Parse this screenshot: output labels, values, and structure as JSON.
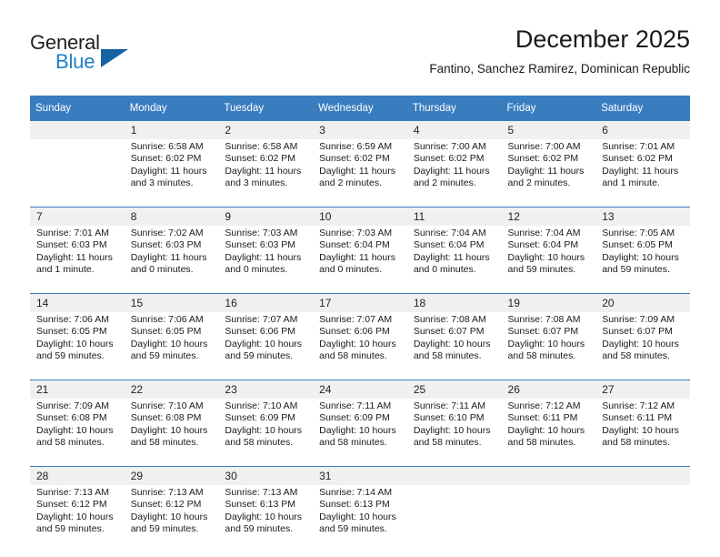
{
  "brand": {
    "name_part1": "General",
    "name_part2": "Blue",
    "triangle_icon": "triangle-icon",
    "color_dark": "#231f20",
    "color_blue": "#1f7fc4"
  },
  "header": {
    "title": "December 2025",
    "subtitle": "Fantino, Sanchez Ramirez, Dominican Republic"
  },
  "theme": {
    "header_bg": "#3a7dbf",
    "daynum_bg": "#f0f0f0",
    "cell_bg": "#ffffff"
  },
  "weekdays": [
    "Sunday",
    "Monday",
    "Tuesday",
    "Wednesday",
    "Thursday",
    "Friday",
    "Saturday"
  ],
  "weeks": [
    {
      "days": [
        {
          "num": "",
          "sunrise": "",
          "sunset": "",
          "daylight1": "",
          "daylight2": ""
        },
        {
          "num": "1",
          "sunrise": "Sunrise: 6:58 AM",
          "sunset": "Sunset: 6:02 PM",
          "daylight1": "Daylight: 11 hours",
          "daylight2": "and 3 minutes."
        },
        {
          "num": "2",
          "sunrise": "Sunrise: 6:58 AM",
          "sunset": "Sunset: 6:02 PM",
          "daylight1": "Daylight: 11 hours",
          "daylight2": "and 3 minutes."
        },
        {
          "num": "3",
          "sunrise": "Sunrise: 6:59 AM",
          "sunset": "Sunset: 6:02 PM",
          "daylight1": "Daylight: 11 hours",
          "daylight2": "and 2 minutes."
        },
        {
          "num": "4",
          "sunrise": "Sunrise: 7:00 AM",
          "sunset": "Sunset: 6:02 PM",
          "daylight1": "Daylight: 11 hours",
          "daylight2": "and 2 minutes."
        },
        {
          "num": "5",
          "sunrise": "Sunrise: 7:00 AM",
          "sunset": "Sunset: 6:02 PM",
          "daylight1": "Daylight: 11 hours",
          "daylight2": "and 2 minutes."
        },
        {
          "num": "6",
          "sunrise": "Sunrise: 7:01 AM",
          "sunset": "Sunset: 6:02 PM",
          "daylight1": "Daylight: 11 hours",
          "daylight2": "and 1 minute."
        }
      ]
    },
    {
      "days": [
        {
          "num": "7",
          "sunrise": "Sunrise: 7:01 AM",
          "sunset": "Sunset: 6:03 PM",
          "daylight1": "Daylight: 11 hours",
          "daylight2": "and 1 minute."
        },
        {
          "num": "8",
          "sunrise": "Sunrise: 7:02 AM",
          "sunset": "Sunset: 6:03 PM",
          "daylight1": "Daylight: 11 hours",
          "daylight2": "and 0 minutes."
        },
        {
          "num": "9",
          "sunrise": "Sunrise: 7:03 AM",
          "sunset": "Sunset: 6:03 PM",
          "daylight1": "Daylight: 11 hours",
          "daylight2": "and 0 minutes."
        },
        {
          "num": "10",
          "sunrise": "Sunrise: 7:03 AM",
          "sunset": "Sunset: 6:04 PM",
          "daylight1": "Daylight: 11 hours",
          "daylight2": "and 0 minutes."
        },
        {
          "num": "11",
          "sunrise": "Sunrise: 7:04 AM",
          "sunset": "Sunset: 6:04 PM",
          "daylight1": "Daylight: 11 hours",
          "daylight2": "and 0 minutes."
        },
        {
          "num": "12",
          "sunrise": "Sunrise: 7:04 AM",
          "sunset": "Sunset: 6:04 PM",
          "daylight1": "Daylight: 10 hours",
          "daylight2": "and 59 minutes."
        },
        {
          "num": "13",
          "sunrise": "Sunrise: 7:05 AM",
          "sunset": "Sunset: 6:05 PM",
          "daylight1": "Daylight: 10 hours",
          "daylight2": "and 59 minutes."
        }
      ]
    },
    {
      "days": [
        {
          "num": "14",
          "sunrise": "Sunrise: 7:06 AM",
          "sunset": "Sunset: 6:05 PM",
          "daylight1": "Daylight: 10 hours",
          "daylight2": "and 59 minutes."
        },
        {
          "num": "15",
          "sunrise": "Sunrise: 7:06 AM",
          "sunset": "Sunset: 6:05 PM",
          "daylight1": "Daylight: 10 hours",
          "daylight2": "and 59 minutes."
        },
        {
          "num": "16",
          "sunrise": "Sunrise: 7:07 AM",
          "sunset": "Sunset: 6:06 PM",
          "daylight1": "Daylight: 10 hours",
          "daylight2": "and 59 minutes."
        },
        {
          "num": "17",
          "sunrise": "Sunrise: 7:07 AM",
          "sunset": "Sunset: 6:06 PM",
          "daylight1": "Daylight: 10 hours",
          "daylight2": "and 58 minutes."
        },
        {
          "num": "18",
          "sunrise": "Sunrise: 7:08 AM",
          "sunset": "Sunset: 6:07 PM",
          "daylight1": "Daylight: 10 hours",
          "daylight2": "and 58 minutes."
        },
        {
          "num": "19",
          "sunrise": "Sunrise: 7:08 AM",
          "sunset": "Sunset: 6:07 PM",
          "daylight1": "Daylight: 10 hours",
          "daylight2": "and 58 minutes."
        },
        {
          "num": "20",
          "sunrise": "Sunrise: 7:09 AM",
          "sunset": "Sunset: 6:07 PM",
          "daylight1": "Daylight: 10 hours",
          "daylight2": "and 58 minutes."
        }
      ]
    },
    {
      "days": [
        {
          "num": "21",
          "sunrise": "Sunrise: 7:09 AM",
          "sunset": "Sunset: 6:08 PM",
          "daylight1": "Daylight: 10 hours",
          "daylight2": "and 58 minutes."
        },
        {
          "num": "22",
          "sunrise": "Sunrise: 7:10 AM",
          "sunset": "Sunset: 6:08 PM",
          "daylight1": "Daylight: 10 hours",
          "daylight2": "and 58 minutes."
        },
        {
          "num": "23",
          "sunrise": "Sunrise: 7:10 AM",
          "sunset": "Sunset: 6:09 PM",
          "daylight1": "Daylight: 10 hours",
          "daylight2": "and 58 minutes."
        },
        {
          "num": "24",
          "sunrise": "Sunrise: 7:11 AM",
          "sunset": "Sunset: 6:09 PM",
          "daylight1": "Daylight: 10 hours",
          "daylight2": "and 58 minutes."
        },
        {
          "num": "25",
          "sunrise": "Sunrise: 7:11 AM",
          "sunset": "Sunset: 6:10 PM",
          "daylight1": "Daylight: 10 hours",
          "daylight2": "and 58 minutes."
        },
        {
          "num": "26",
          "sunrise": "Sunrise: 7:12 AM",
          "sunset": "Sunset: 6:11 PM",
          "daylight1": "Daylight: 10 hours",
          "daylight2": "and 58 minutes."
        },
        {
          "num": "27",
          "sunrise": "Sunrise: 7:12 AM",
          "sunset": "Sunset: 6:11 PM",
          "daylight1": "Daylight: 10 hours",
          "daylight2": "and 58 minutes."
        }
      ]
    },
    {
      "days": [
        {
          "num": "28",
          "sunrise": "Sunrise: 7:13 AM",
          "sunset": "Sunset: 6:12 PM",
          "daylight1": "Daylight: 10 hours",
          "daylight2": "and 59 minutes."
        },
        {
          "num": "29",
          "sunrise": "Sunrise: 7:13 AM",
          "sunset": "Sunset: 6:12 PM",
          "daylight1": "Daylight: 10 hours",
          "daylight2": "and 59 minutes."
        },
        {
          "num": "30",
          "sunrise": "Sunrise: 7:13 AM",
          "sunset": "Sunset: 6:13 PM",
          "daylight1": "Daylight: 10 hours",
          "daylight2": "and 59 minutes."
        },
        {
          "num": "31",
          "sunrise": "Sunrise: 7:14 AM",
          "sunset": "Sunset: 6:13 PM",
          "daylight1": "Daylight: 10 hours",
          "daylight2": "and 59 minutes."
        },
        {
          "num": "",
          "sunrise": "",
          "sunset": "",
          "daylight1": "",
          "daylight2": ""
        },
        {
          "num": "",
          "sunrise": "",
          "sunset": "",
          "daylight1": "",
          "daylight2": ""
        },
        {
          "num": "",
          "sunrise": "",
          "sunset": "",
          "daylight1": "",
          "daylight2": ""
        }
      ]
    }
  ]
}
